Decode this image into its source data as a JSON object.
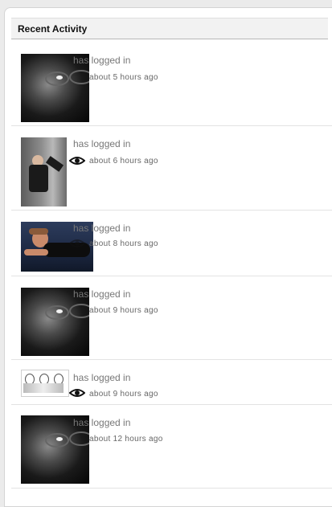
{
  "header": {
    "title": "Recent Activity"
  },
  "activities": [
    {
      "action": "has logged in",
      "time": "about 5 hours ago",
      "avatar": "portrait-dark-glasses-photo"
    },
    {
      "action": "has logged in",
      "time": "about 6 hours ago",
      "avatar": "person-sitting-against-wall-photo"
    },
    {
      "action": "has logged in",
      "time": "about 8 hours ago",
      "avatar": "man-lying-on-floor-photo"
    },
    {
      "action": "has logged in",
      "time": "about 9 hours ago",
      "avatar": "portrait-dark-glasses-photo"
    },
    {
      "action": "has logged in",
      "time": "about 9 hours ago",
      "avatar": "three-faces-sketch-photo"
    },
    {
      "action": "has logged in",
      "time": "about 12 hours ago",
      "avatar": "portrait-dark-glasses-photo"
    }
  ],
  "icons": {
    "view": "eye-icon"
  }
}
